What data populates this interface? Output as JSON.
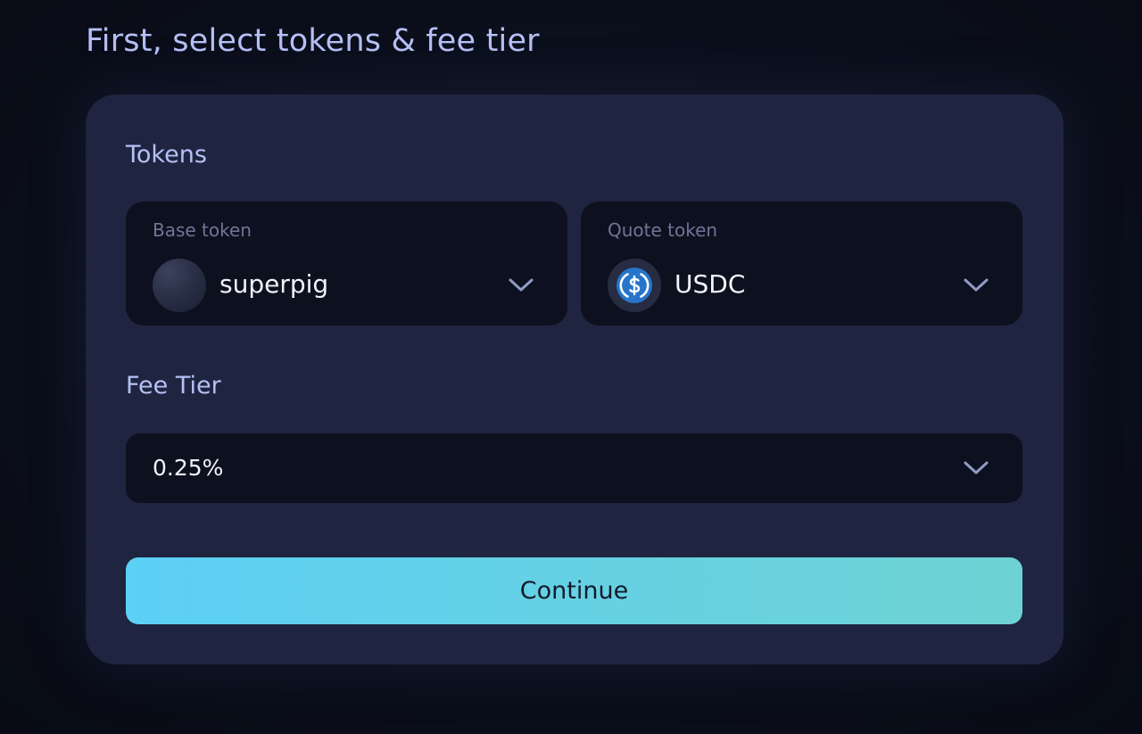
{
  "page": {
    "title": "First, select tokens & fee tier"
  },
  "tokens": {
    "label": "Tokens",
    "base": {
      "caption": "Base token",
      "name": "superpig",
      "icon": "token-avatar-icon"
    },
    "quote": {
      "caption": "Quote token",
      "name": "USDC",
      "icon": "usdc-icon"
    }
  },
  "fee": {
    "label": "Fee Tier",
    "value": "0.25%"
  },
  "actions": {
    "continue_label": "Continue"
  },
  "colors": {
    "accent_start": "#5cd0f5",
    "accent_end": "#6ed2d3",
    "card_background": "#1f2540",
    "field_background": "#0d111f",
    "heading": "#b6c0f5",
    "usdc_blue": "#2775ca"
  }
}
